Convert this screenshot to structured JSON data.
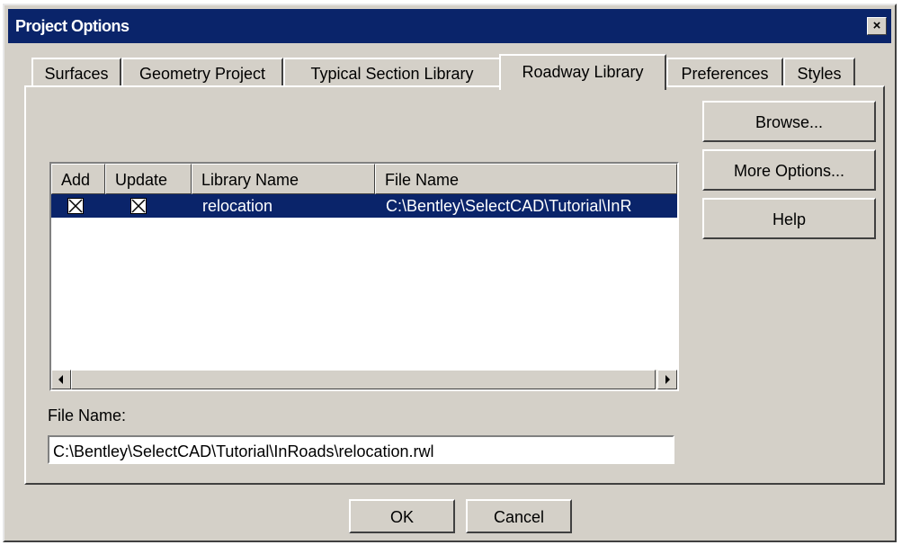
{
  "window": {
    "title": "Project Options",
    "close_glyph": "×"
  },
  "tabs": [
    {
      "label": "Surfaces",
      "active": false
    },
    {
      "label": "Geometry Project",
      "active": false
    },
    {
      "label": "Typical Section Library",
      "active": false
    },
    {
      "label": "Roadway Library",
      "active": true
    },
    {
      "label": "Preferences",
      "active": false
    },
    {
      "label": "Styles",
      "active": false
    }
  ],
  "side_buttons": {
    "browse": "Browse...",
    "more_options": "More Options...",
    "help": "Help"
  },
  "library_list": {
    "columns": [
      "Add",
      "Update",
      "Library Name",
      "File Name"
    ],
    "rows": [
      {
        "add": true,
        "update": true,
        "library_name": "relocation",
        "file_name": "C:\\Bentley\\SelectCAD\\Tutorial\\InR",
        "selected": true
      }
    ]
  },
  "file_name_label": "File Name:",
  "file_name_value": "C:\\Bentley\\SelectCAD\\Tutorial\\InRoads\\relocation.rwl",
  "dialog_buttons": {
    "ok": "OK",
    "cancel": "Cancel"
  },
  "colors": {
    "titlebar": "#0a246a",
    "face": "#d4d0c8",
    "selection": "#0a246a"
  }
}
